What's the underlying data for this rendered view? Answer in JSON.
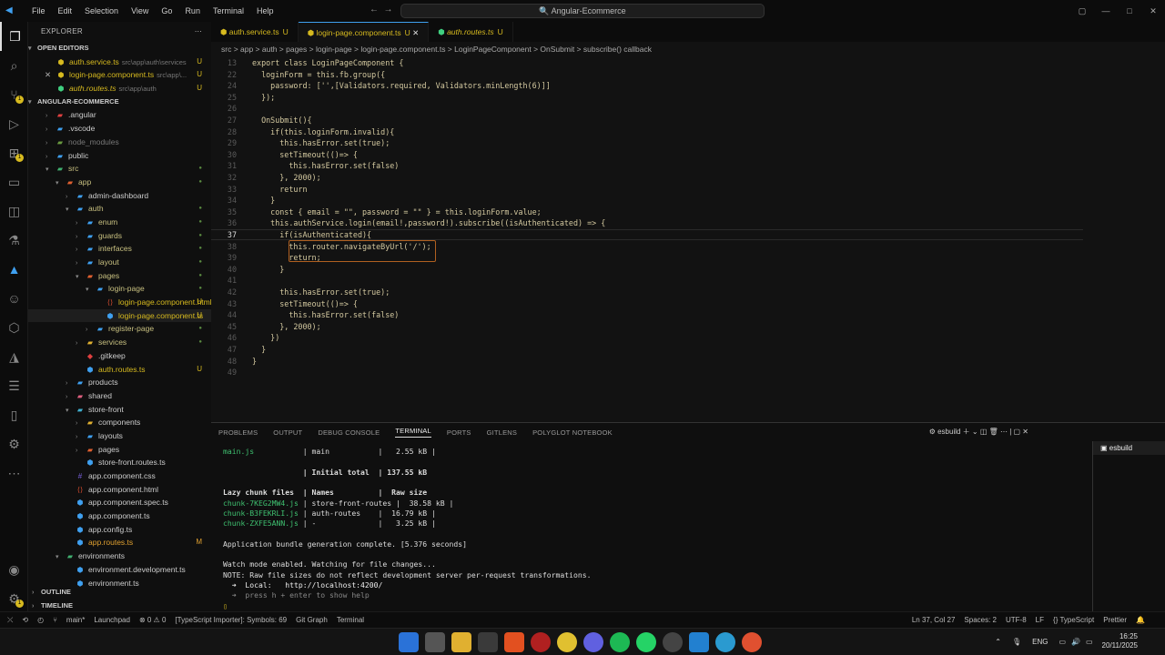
{
  "titlebar": {
    "menu": [
      "File",
      "Edit",
      "Selection",
      "View",
      "Go",
      "Run",
      "Terminal",
      "Help"
    ],
    "search": "Angular-Ecommerce"
  },
  "sidebar": {
    "title": "EXPLORER",
    "open_editors_label": "OPEN EDITORS",
    "open_editors": [
      {
        "name": "auth.service.ts",
        "path": "src\\app\\auth\\services",
        "status": "U"
      },
      {
        "name": "login-page.component.ts",
        "path": "src\\app\\...",
        "status": "U"
      },
      {
        "name": "auth.routes.ts",
        "path": "src\\app\\auth",
        "status": "U"
      }
    ],
    "project_label": "ANGULAR-ECOMMERCE",
    "tree": [
      {
        "name": ".angular",
        "depth": 1,
        "type": "folder",
        "open": false
      },
      {
        "name": ".vscode",
        "depth": 1,
        "type": "folder",
        "open": false
      },
      {
        "name": "node_modules",
        "depth": 1,
        "type": "folder",
        "open": false,
        "dim": true
      },
      {
        "name": "public",
        "depth": 1,
        "type": "folder",
        "open": false
      },
      {
        "name": "src",
        "depth": 1,
        "type": "folder",
        "open": true,
        "dot": true
      },
      {
        "name": "app",
        "depth": 2,
        "type": "folder",
        "open": true,
        "dot": true
      },
      {
        "name": "admin-dashboard",
        "depth": 3,
        "type": "folder",
        "open": false
      },
      {
        "name": "auth",
        "depth": 3,
        "type": "folder",
        "open": true,
        "dot": true
      },
      {
        "name": "enum",
        "depth": 4,
        "type": "folder",
        "open": false,
        "dot": true
      },
      {
        "name": "guards",
        "depth": 4,
        "type": "folder",
        "open": false,
        "dot": true
      },
      {
        "name": "interfaces",
        "depth": 4,
        "type": "folder",
        "open": false,
        "dot": true
      },
      {
        "name": "layout",
        "depth": 4,
        "type": "folder",
        "open": false,
        "dot": true
      },
      {
        "name": "pages",
        "depth": 4,
        "type": "folder",
        "open": true,
        "dot": true
      },
      {
        "name": "login-page",
        "depth": 5,
        "type": "folder",
        "open": true,
        "dot": true
      },
      {
        "name": "login-page.component.html",
        "depth": 6,
        "type": "file",
        "status": "U"
      },
      {
        "name": "login-page.component.ts",
        "depth": 6,
        "type": "file",
        "status": "U",
        "selected": true
      },
      {
        "name": "register-page",
        "depth": 5,
        "type": "folder",
        "open": false,
        "dot": true
      },
      {
        "name": "services",
        "depth": 4,
        "type": "folder",
        "open": false,
        "dot": true
      },
      {
        "name": ".gitkeep",
        "depth": 4,
        "type": "file"
      },
      {
        "name": "auth.routes.ts",
        "depth": 4,
        "type": "file",
        "status": "U"
      },
      {
        "name": "products",
        "depth": 3,
        "type": "folder",
        "open": false
      },
      {
        "name": "shared",
        "depth": 3,
        "type": "folder",
        "open": false
      },
      {
        "name": "store-front",
        "depth": 3,
        "type": "folder",
        "open": true
      },
      {
        "name": "components",
        "depth": 4,
        "type": "folder",
        "open": false
      },
      {
        "name": "layouts",
        "depth": 4,
        "type": "folder",
        "open": false
      },
      {
        "name": "pages",
        "depth": 4,
        "type": "folder",
        "open": false
      },
      {
        "name": "store-front.routes.ts",
        "depth": 4,
        "type": "file"
      },
      {
        "name": "app.component.css",
        "depth": 3,
        "type": "file"
      },
      {
        "name": "app.component.html",
        "depth": 3,
        "type": "file"
      },
      {
        "name": "app.component.spec.ts",
        "depth": 3,
        "type": "file"
      },
      {
        "name": "app.component.ts",
        "depth": 3,
        "type": "file"
      },
      {
        "name": "app.config.ts",
        "depth": 3,
        "type": "file"
      },
      {
        "name": "app.routes.ts",
        "depth": 3,
        "type": "file",
        "status": "M"
      },
      {
        "name": "environments",
        "depth": 2,
        "type": "folder",
        "open": true
      },
      {
        "name": "environment.development.ts",
        "depth": 3,
        "type": "file"
      },
      {
        "name": "environment.ts",
        "depth": 3,
        "type": "file"
      }
    ],
    "outline_label": "OUTLINE",
    "timeline_label": "TIMELINE"
  },
  "tabs": [
    {
      "name": "auth.service.ts",
      "status": "U"
    },
    {
      "name": "login-page.component.ts",
      "status": "U",
      "active": true
    },
    {
      "name": "auth.routes.ts",
      "status": "U"
    }
  ],
  "breadcrumb": "src > app > auth > pages > login-page > login-page.component.ts > LoginPageComponent > OnSubmit > subscribe() callback",
  "code": [
    {
      "n": "13",
      "t": "export class LoginPageComponent {"
    },
    {
      "n": "22",
      "t": "  loginForm = this.fb.group({"
    },
    {
      "n": "24",
      "t": "    password: ['',[Validators.required, Validators.minLength(6)]]"
    },
    {
      "n": "25",
      "t": "  });"
    },
    {
      "n": "26",
      "t": ""
    },
    {
      "n": "27",
      "t": "  OnSubmit(){"
    },
    {
      "n": "28",
      "t": "    if(this.loginForm.invalid){"
    },
    {
      "n": "29",
      "t": "      this.hasError.set(true);"
    },
    {
      "n": "30",
      "t": "      setTimeout(()=> {"
    },
    {
      "n": "31",
      "t": "        this.hasError.set(false)"
    },
    {
      "n": "32",
      "t": "      }, 2000);"
    },
    {
      "n": "33",
      "t": "      return"
    },
    {
      "n": "34",
      "t": "    }"
    },
    {
      "n": "35",
      "t": "    const { email = \"\", password = \"\" } = this.loginForm.value;"
    },
    {
      "n": "36",
      "t": "    this.authService.login(email!,password!).subscribe((isAuthenticated) => {"
    },
    {
      "n": "37",
      "t": "      if(isAuthenticated){"
    },
    {
      "n": "38",
      "t": "        this.router.navigateByUrl('/');"
    },
    {
      "n": "39",
      "t": "        return;"
    },
    {
      "n": "40",
      "t": "      }"
    },
    {
      "n": "41",
      "t": ""
    },
    {
      "n": "42",
      "t": "      this.hasError.set(true);"
    },
    {
      "n": "43",
      "t": "      setTimeout(()=> {"
    },
    {
      "n": "44",
      "t": "        this.hasError.set(false)"
    },
    {
      "n": "45",
      "t": "      }, 2000);"
    },
    {
      "n": "46",
      "t": "    })"
    },
    {
      "n": "47",
      "t": "  }"
    },
    {
      "n": "48",
      "t": "}"
    },
    {
      "n": "49",
      "t": ""
    }
  ],
  "panel": {
    "tabs": [
      "PROBLEMS",
      "OUTPUT",
      "DEBUG CONSOLE",
      "TERMINAL",
      "PORTS",
      "GITLENS",
      "POLYGLOT NOTEBOOK"
    ],
    "active_tab": "TERMINAL",
    "terminal_name": "esbuild",
    "terminal_lines": [
      "main.js           | main           |   2.55 kB |",
      "",
      "                  | Initial total  | 137.55 kB",
      "",
      "Lazy chunk files  | Names          |  Raw size",
      "chunk-7KEG2MW4.js | store-front-routes |  38.58 kB |",
      "chunk-B3FEKRLI.js | auth-routes    |  16.79 kB |",
      "chunk-ZXFE5ANN.js | -              |   3.25 kB |",
      "",
      "Application bundle generation complete. [5.376 seconds]",
      "",
      "Watch mode enabled. Watching for file changes...",
      "NOTE: Raw file sizes do not reflect development server per-request transformations.",
      "  ➜  Local:   http://localhost:4200/",
      "  ➜  press h + enter to show help"
    ]
  },
  "statusbar": {
    "left": [
      "main*",
      "Launchpad",
      "⊗ 0  ⚠ 0",
      "[TypeScript Importer]: Symbols: 69",
      "Git Graph",
      "Terminal"
    ],
    "right": [
      "Ln 37, Col 27",
      "Spaces: 2",
      "UTF-8",
      "LF",
      "{} TypeScript",
      "Prettier"
    ]
  },
  "taskbar": {
    "lang": "ENG",
    "time": "16:25",
    "date": "20/11/2025"
  },
  "colors": {
    "accent": "#3fa0f0",
    "untracked": "#d7ba1f",
    "modified": "#e0a030",
    "bg": "#121212"
  }
}
